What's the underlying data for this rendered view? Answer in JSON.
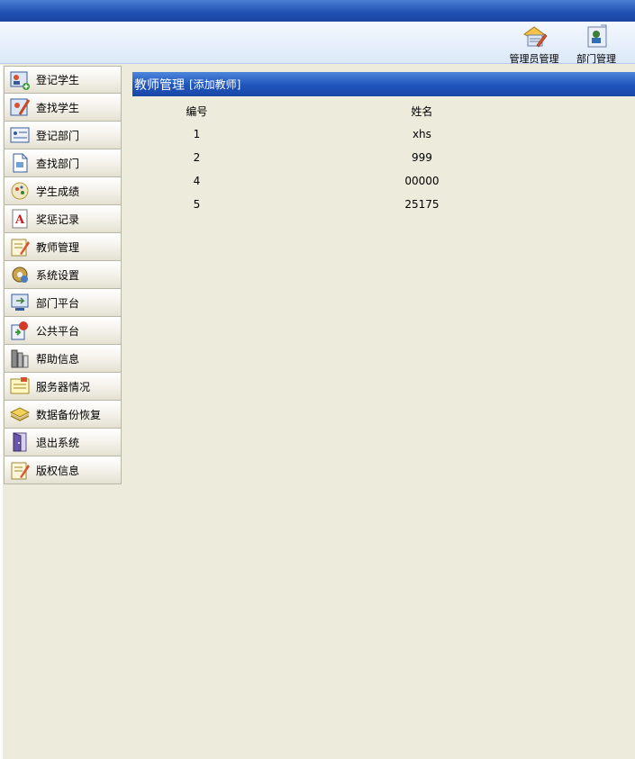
{
  "toolbar": {
    "admin_label": "管理员管理",
    "dept_label": "部门管理"
  },
  "menu": [
    {
      "label": "登记学生",
      "icon": "register-student-icon"
    },
    {
      "label": "查找学生",
      "icon": "find-student-icon"
    },
    {
      "label": "登记部门",
      "icon": "register-dept-icon"
    },
    {
      "label": "查找部门",
      "icon": "find-dept-icon"
    },
    {
      "label": "学生成绩",
      "icon": "student-score-icon"
    },
    {
      "label": "奖惩记录",
      "icon": "reward-record-icon"
    },
    {
      "label": "教师管理",
      "icon": "teacher-manage-icon"
    },
    {
      "label": "系统设置",
      "icon": "system-settings-icon"
    },
    {
      "label": "部门平台",
      "icon": "dept-platform-icon"
    },
    {
      "label": "公共平台",
      "icon": "public-platform-icon"
    },
    {
      "label": "帮助信息",
      "icon": "help-info-icon"
    },
    {
      "label": "服务器情况",
      "icon": "server-status-icon"
    },
    {
      "label": "数据备份恢复",
      "icon": "backup-restore-icon"
    },
    {
      "label": "退出系统",
      "icon": "exit-icon"
    },
    {
      "label": "版权信息",
      "icon": "copyright-icon"
    }
  ],
  "content": {
    "title": "教师管理",
    "add_link": "[添加教师]",
    "columns": [
      "编号",
      "姓名"
    ],
    "rows": [
      [
        "1",
        "xhs"
      ],
      [
        "2",
        "999"
      ],
      [
        "4",
        "00000"
      ],
      [
        "5",
        "25175"
      ]
    ]
  }
}
